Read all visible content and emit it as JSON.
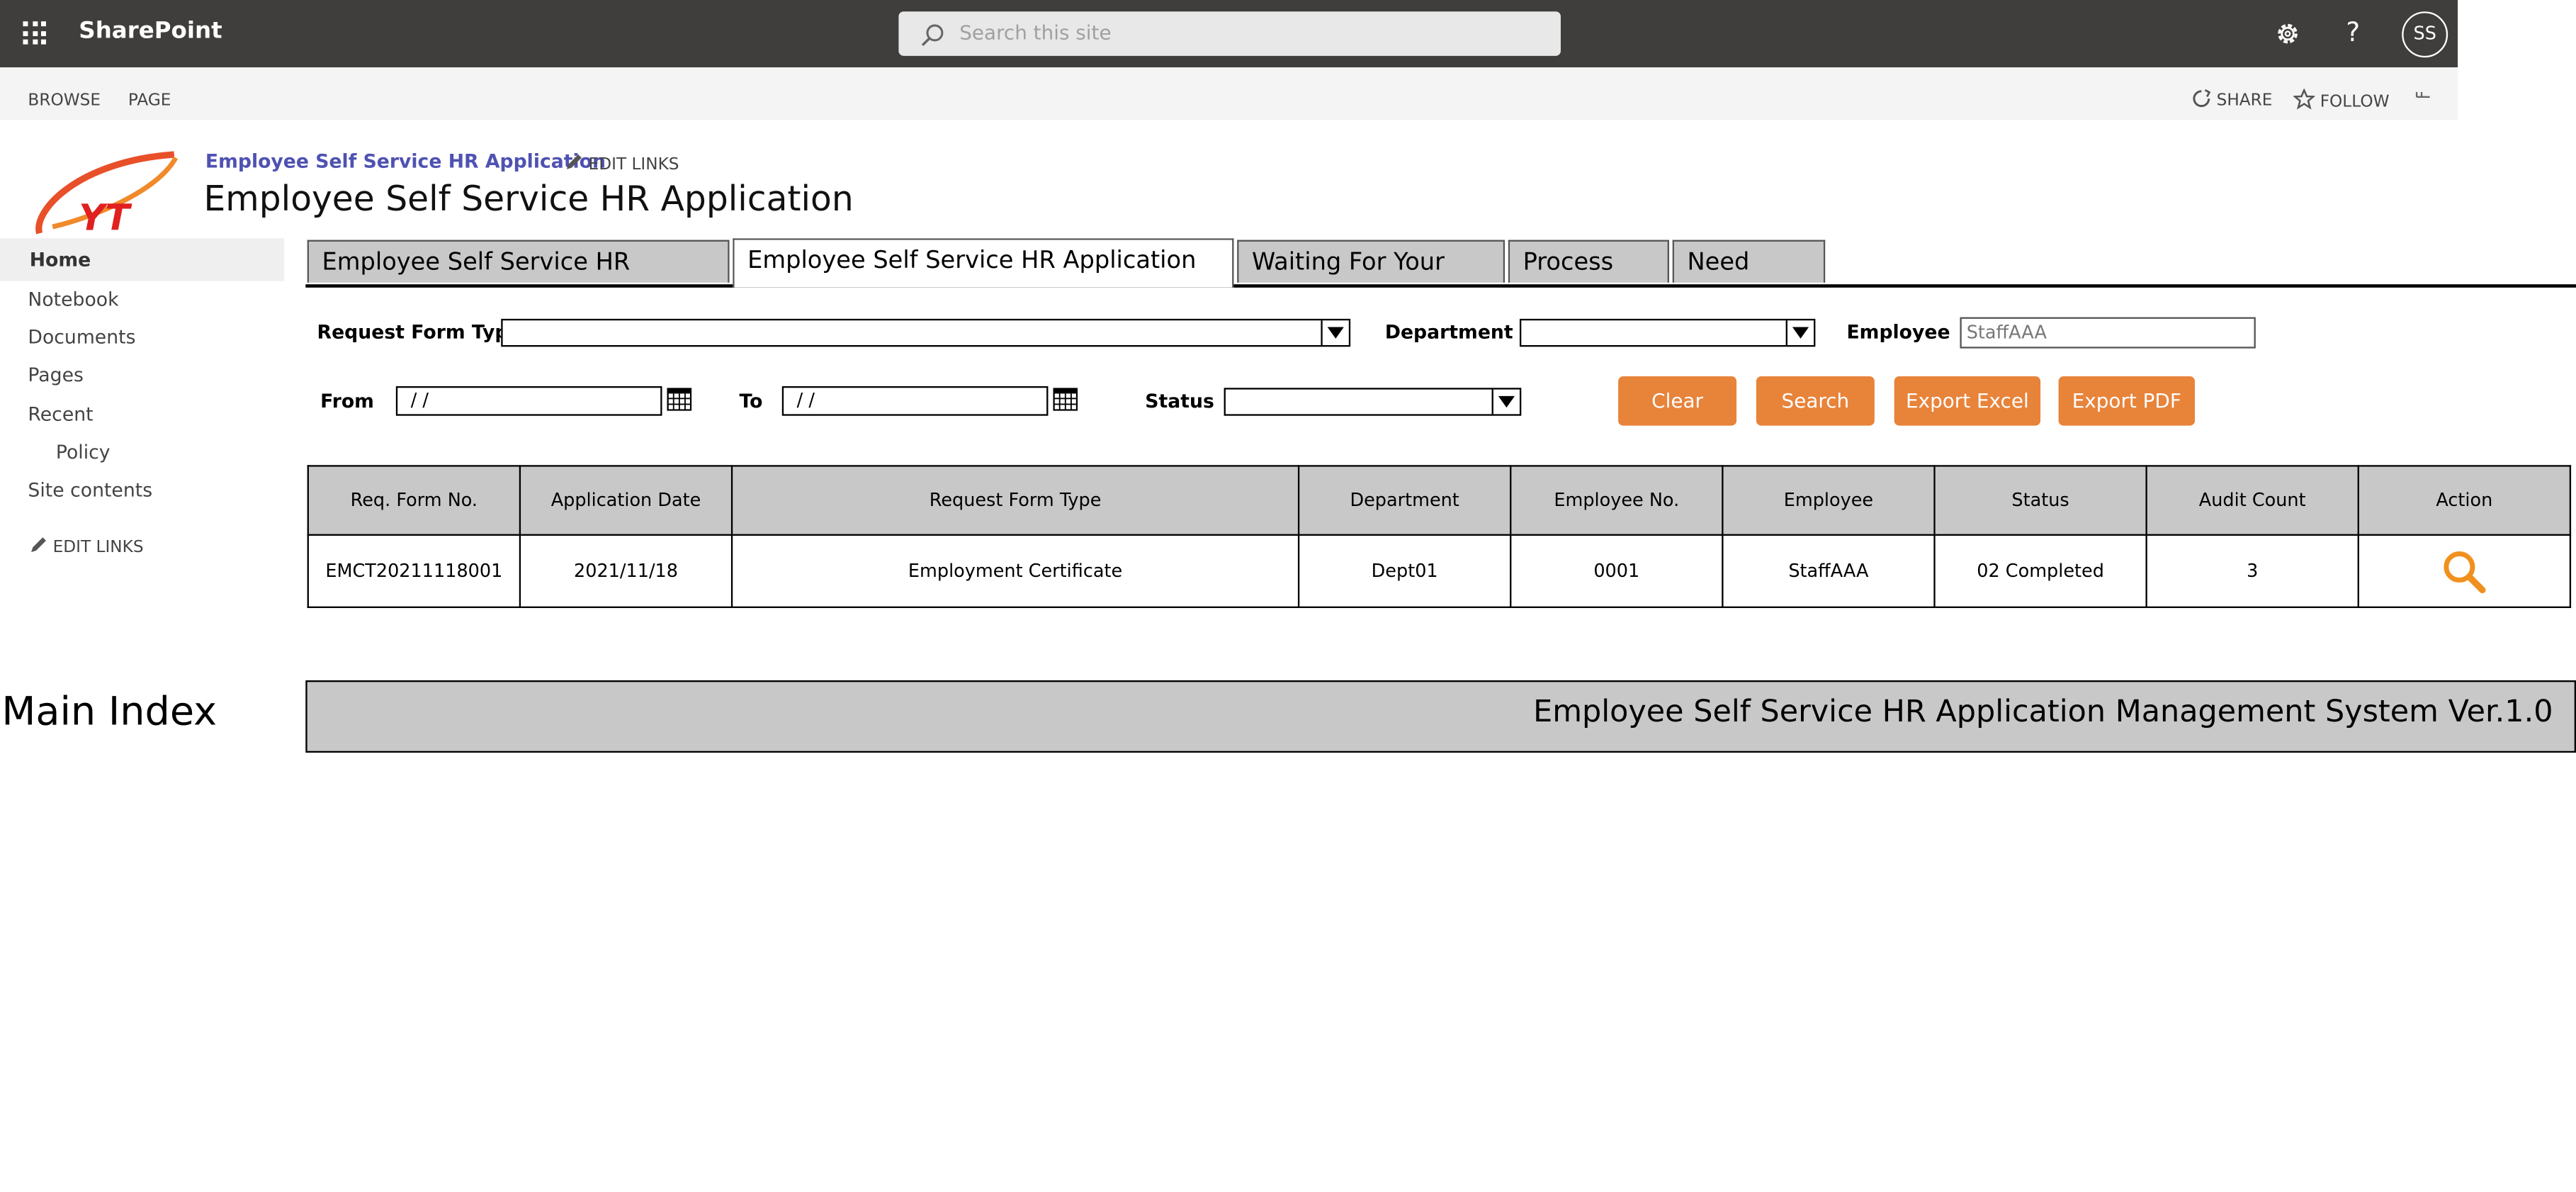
{
  "suite_bar": {
    "app_name": "SharePoint",
    "search_placeholder": "Search this site",
    "user_initials": "SS"
  },
  "ribbon": {
    "tabs": [
      "BROWSE",
      "PAGE"
    ],
    "actions": {
      "share": "SHARE",
      "follow": "FOLLOW"
    }
  },
  "header": {
    "breadcrumb": "Employee Self Service HR Application",
    "edit_links": "EDIT LINKS",
    "page_title": "Employee Self Service HR Application",
    "logo_text": "YT"
  },
  "left_nav": {
    "items": [
      {
        "label": "Home"
      },
      {
        "label": "Notebook"
      },
      {
        "label": "Documents"
      },
      {
        "label": "Pages"
      },
      {
        "label": "Recent"
      },
      {
        "label": "Policy"
      },
      {
        "label": "Site contents"
      }
    ],
    "edit_links": "EDIT LINKS"
  },
  "tabs": [
    {
      "label": "Employee Self Service HR Application"
    },
    {
      "label": "Employee Self Service HR Application History"
    },
    {
      "label": "Waiting For Your Input"
    },
    {
      "label": "Process Flow"
    },
    {
      "label": "Need Help?"
    }
  ],
  "active_tab": "Employee Self Service HR Application History",
  "filters": {
    "request_form_type_label": "Request Form Type",
    "department_label": "Department",
    "employee_label": "Employee",
    "employee_value": "StaffAAA",
    "from_label": "From",
    "from_value": "/ /",
    "to_label": "To",
    "to_value": "/ /",
    "status_label": "Status"
  },
  "buttons": {
    "clear": "Clear",
    "search": "Search",
    "export_excel": "Export Excel",
    "export_pdf": "Export PDF"
  },
  "table": {
    "columns": [
      "Req. Form No.",
      "Application Date",
      "Request Form Type",
      "Department",
      "Employee No.",
      "Employee",
      "Status",
      "Audit Count",
      "Action"
    ],
    "rows": [
      {
        "req_form_no": "EMCT20211118001",
        "application_date": "2021/11/18",
        "request_form_type": "Employment Certificate",
        "department": "Dept01",
        "employee_no": "0001",
        "employee": "StaffAAA",
        "status": "02 Completed",
        "audit_count": "3",
        "action_icon": "magnifier-icon"
      }
    ]
  },
  "main_index_label": "Main Index",
  "footer_text": "Employee Self Service HR Application Management System Ver.1.0",
  "colors": {
    "suite_bar": "#403e3c",
    "accent_button": "#e8833a",
    "breadcrumb_link": "#4f52b2",
    "tab_bg": "#c8c8c8"
  }
}
